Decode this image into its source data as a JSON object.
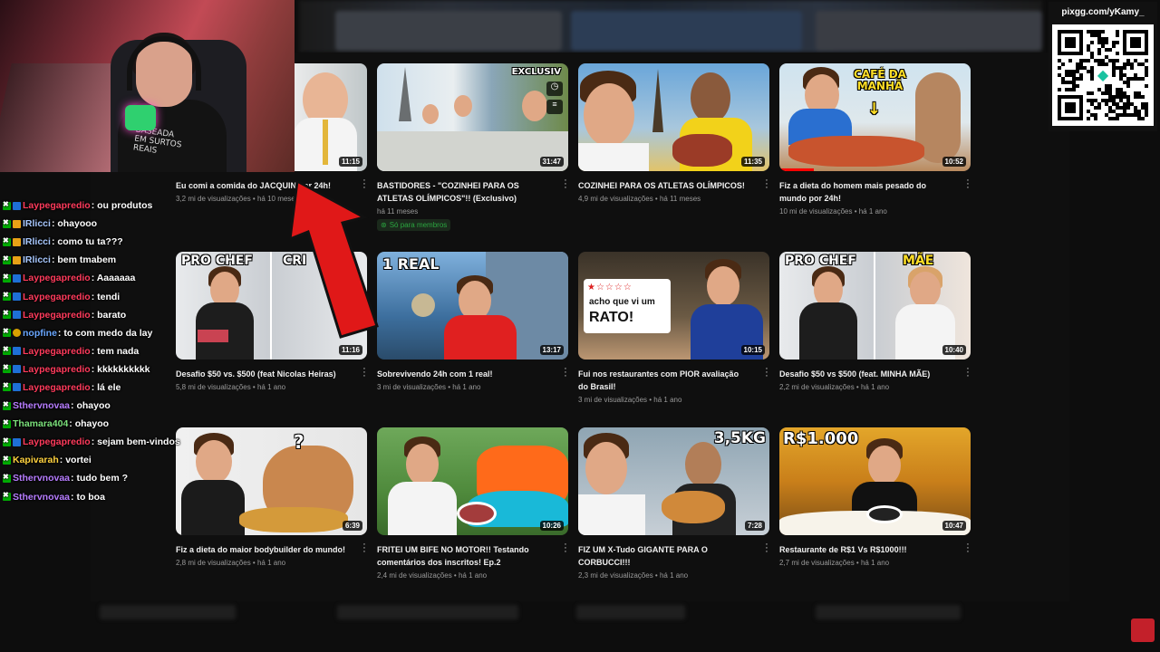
{
  "qr": {
    "label": "pixgg.com/yKamy_"
  },
  "webcam": {
    "shirt_text": "BASEADA\nEM SURTOS\nREAIS"
  },
  "chat": [
    {
      "user": "Laypegapredio",
      "msg": ": ou produtos",
      "color": "#ff3b5c",
      "badges": [
        "mod",
        "prime"
      ]
    },
    {
      "user": "IRlicci",
      "msg": ": ohayooo",
      "color": "#a8c8ff",
      "badges": [
        "mod",
        "vip"
      ]
    },
    {
      "user": "IRlicci",
      "msg": ": como tu ta???",
      "color": "#a8c8ff",
      "badges": [
        "mod",
        "vip"
      ]
    },
    {
      "user": "IRlicci",
      "msg": ": bem tmabem",
      "color": "#a8c8ff",
      "badges": [
        "mod",
        "vip"
      ]
    },
    {
      "user": "Laypegapredio",
      "msg": ": Aaaaaaa",
      "color": "#ff3b5c",
      "badges": [
        "mod",
        "prime"
      ]
    },
    {
      "user": "Laypegapredio",
      "msg": ": tendi",
      "color": "#ff3b5c",
      "badges": [
        "mod",
        "prime"
      ]
    },
    {
      "user": "Laypegapredio",
      "msg": ": barato",
      "color": "#ff3b5c",
      "badges": [
        "mod",
        "prime"
      ]
    },
    {
      "user": "nopfine",
      "msg": ": to com medo da lay",
      "color": "#6aa7ff",
      "badges": [
        "mod",
        "info"
      ]
    },
    {
      "user": "Laypegapredio",
      "msg": ": tem nada",
      "color": "#ff3b5c",
      "badges": [
        "mod",
        "prime"
      ]
    },
    {
      "user": "Laypegapredio",
      "msg": ": kkkkkkkkkk",
      "color": "#ff3b5c",
      "badges": [
        "mod",
        "prime"
      ]
    },
    {
      "user": "Laypegapredio",
      "msg": ": lá ele",
      "color": "#ff3b5c",
      "badges": [
        "mod",
        "prime"
      ]
    },
    {
      "user": "Sthervnovaa",
      "msg": ": ohayoo",
      "color": "#b77dff",
      "badges": [
        "mod"
      ]
    },
    {
      "user": "Thamara404",
      "msg": ": ohayoo",
      "color": "#7be07b",
      "badges": [
        "mod"
      ]
    },
    {
      "user": "Laypegapredio",
      "msg": ": sejam bem-vindos",
      "color": "#ff3b5c",
      "badges": [
        "mod",
        "prime"
      ]
    },
    {
      "user": "Kapivarah",
      "msg": ": vortei",
      "color": "#ffd23f",
      "badges": [
        "mod"
      ]
    },
    {
      "user": "Sthervnovaa",
      "msg": ": tudo bem ?",
      "color": "#b77dff",
      "badges": [
        "mod"
      ]
    },
    {
      "user": "Sthervnovaa",
      "msg": ": to boa",
      "color": "#b77dff",
      "badges": [
        "mod"
      ]
    }
  ],
  "videos": [
    {
      "title": "Eu comi a comida do JACQUIN por 24h!",
      "meta": "3,2 mi de visualizações • há 10 meses",
      "duration": "11:15"
    },
    {
      "title": "BASTIDORES - \"COZINHEI PARA OS ATLETAS OLÍMPICOS\"!! (Exclusivo)",
      "meta": "há 11 meses",
      "duration": "31:47",
      "members": "Só para membros",
      "overlay": "EXCLUSIV"
    },
    {
      "title": "COZINHEI PARA OS ATLETAS OLÍMPICOS!",
      "meta": "4,9 mi de visualizações • há 11 meses",
      "duration": "11:35"
    },
    {
      "title": "Fiz a dieta do homem mais pesado do mundo por 24h!",
      "meta": "10 mi de visualizações • há 1 ano",
      "duration": "10:52",
      "overlay": "CAFÉ DA MANHÃ"
    },
    {
      "title": "Desafio $50 vs. $500 (feat Nicolas Heiras)",
      "meta": "5,8 mi de visualizações • há 1 ano",
      "duration": "11:16",
      "overlay": "PRO CHEF",
      "overlay2": "CRI"
    },
    {
      "title": "Sobrevivendo 24h com 1 real!",
      "meta": "3 mi de visualizações • há 1 ano",
      "duration": "13:17",
      "overlay": "1 REAL"
    },
    {
      "title": "Fui nos restaurantes com PIOR avaliação do Brasil!",
      "meta": "3 mi de visualizações • há 1 ano",
      "duration": "10:15",
      "overlay": "acho que vi um",
      "overlay2": "RATO!"
    },
    {
      "title": "Desafio $50 vs $500 (feat. MINHA MÃE)",
      "meta": "2,2 mi de visualizações • há 1 ano",
      "duration": "10:40",
      "overlay": "PRO CHEF",
      "overlay2": "MÃE"
    },
    {
      "title": "Fiz a dieta do maior bodybuilder do mundo!",
      "meta": "2,8 mi de visualizações • há 1 ano",
      "duration": "6:39",
      "overlay": "?"
    },
    {
      "title": "FRITEI UM BIFE NO MOTOR!! Testando comentários dos inscritos! Ep.2",
      "meta": "2,4 mi de visualizações • há 1 ano",
      "duration": "10:26"
    },
    {
      "title": "FIZ UM X-Tudo GIGANTE PARA O CORBUCCI!!!",
      "meta": "2,3 mi de visualizações • há 1 ano",
      "duration": "7:28",
      "overlay": "3,5KG"
    },
    {
      "title": "Restaurante de R$1 Vs R$1000!!!",
      "meta": "2,7 mi de visualizações • há 1 ano",
      "duration": "10:47",
      "overlay": "R$1.000"
    }
  ]
}
